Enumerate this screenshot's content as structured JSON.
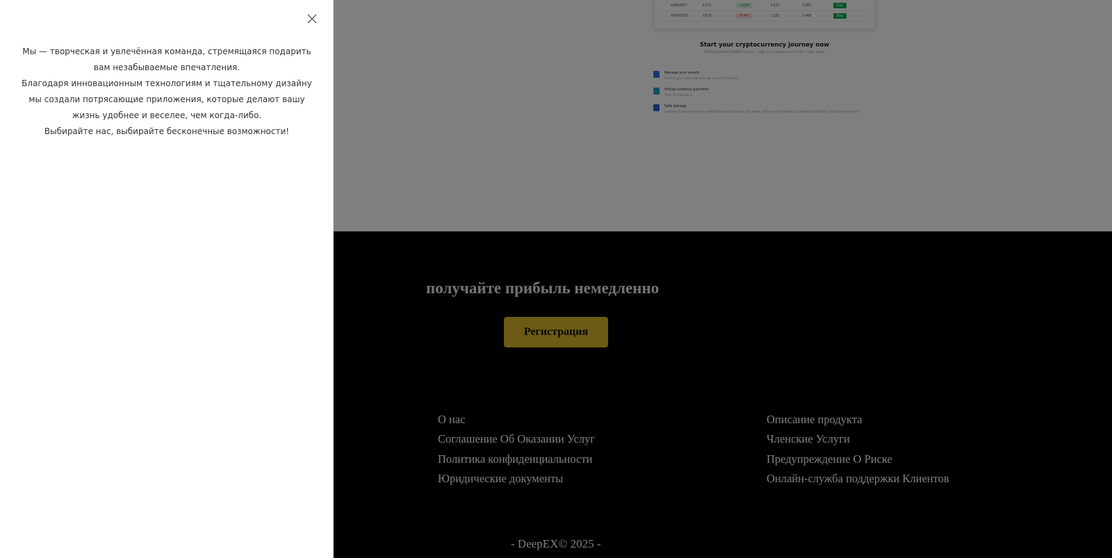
{
  "drawer": {
    "about_lines": [
      "Мы — творческая и увлечённая команда, стремящаяся подарить вам незабываемые впечатления.",
      "Благодаря инновационным технологиям и тщательному дизайну мы создали потрясающие приложения, которые делают вашу жизнь удобнее и веселее, чем когда-либо.",
      "Выбирайте нас, выбирайте бесконечные возможности!"
    ]
  },
  "market": {
    "rows": [
      {
        "pair": "UNI/USDT",
        "price": "6.171",
        "change": "+0.5%",
        "change_dir": "up",
        "high": "6.137",
        "low": "5.987",
        "action": "Buy"
      },
      {
        "pair": "XRP/USDT",
        "price": "0.578",
        "change": "-0.4%",
        "change_dir": "down",
        "high": "1.115",
        "low": "0.495",
        "action": "Buy"
      }
    ]
  },
  "journey": {
    "title": "Start your cryptocurrency journey now",
    "subtitle": "Getting started DeepEX is easy — sign up in minutes and trade crypto today"
  },
  "features": [
    {
      "name": "Manage your assets",
      "desc": "Trade crypto assets with leverage of up to 100 times",
      "color": "#2f6fe0"
    },
    {
      "name": "Virtual currency payment",
      "desc": "Trade through token",
      "color": "#1fa0c9"
    },
    {
      "name": "Safe storage",
      "desc": "Customer funds are stored in a dedicated multi-signature cold wallet, 24/7 security monitoring, dedicated 20000 BTC security reserve fund",
      "color": "#2a5fd8"
    }
  ],
  "cta": {
    "heading": "получайте прибыль немедленно",
    "register_label": "Регистрация",
    "accent": "#d9b52a"
  },
  "footer": {
    "left_links": [
      "О нас",
      "Соглашение Об Оказании Услуг",
      "Политика конфиденциальности",
      "Юридические документы"
    ],
    "right_links": [
      "Описание продукта",
      "Членские Услуги",
      "Предупреждение О Риске",
      "Онлайн-служба поддержки Клиентов"
    ],
    "copyright": "- DeepEX© 2025 -"
  }
}
